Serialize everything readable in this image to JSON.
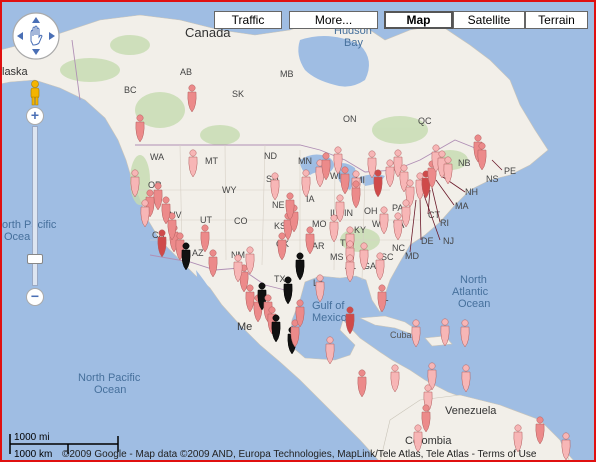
{
  "map": {
    "labels": {
      "canada": "Canada",
      "hudson_bay_1": "Hudson",
      "hudson_bay_2": "Bay",
      "alaska": "laska",
      "north_pacific_1": "orth Pacific",
      "north_pacific_2": "Ocea",
      "north_pacific_lower_1": "North Pacific",
      "north_pacific_lower_2": "Ocean",
      "gulf_1": "Gulf of",
      "gulf_2": "Mexico",
      "north_atlantic_1": "North",
      "north_atlantic_2": "Atlantic",
      "north_atlantic_3": "Ocean",
      "cuba": "Cuba",
      "venezuela": "Venezuela",
      "colombia": "Colombia",
      "mexico": "Me",
      "provinces": {
        "bc": "BC",
        "ab": "AB",
        "sk": "SK",
        "mb": "MB",
        "on": "ON",
        "qc": "QC",
        "nb": "NB",
        "ns": "NS",
        "pe": "PE"
      },
      "states": {
        "wa": "WA",
        "or": "OR",
        "mt": "MT",
        "nd": "ND",
        "mn": "MN",
        "wi": "WI",
        "mi": "MI",
        "wy": "WY",
        "sd": "SD",
        "ne": "NE",
        "ia": "IA",
        "il": "IL",
        "in": "IN",
        "oh": "OH",
        "pa": "PA",
        "nv": "NV",
        "ut": "UT",
        "co": "CO",
        "ks": "KS",
        "mo": "MO",
        "ky": "KY",
        "wv": "WV",
        "va": "VA",
        "ca": "CA",
        "az": "AZ",
        "nm": "NM",
        "ok": "OK",
        "ar": "AR",
        "tn": "TN",
        "nc": "NC",
        "sc": "SC",
        "ga": "GA",
        "al": "AL",
        "ms": "MS",
        "la": "LA",
        "tx": "TX",
        "fl": "FL",
        "md": "MD",
        "de": "DE",
        "nj": "NJ",
        "ct": "CT",
        "ri": "RI",
        "ma": "MA",
        "nh": "NH"
      }
    }
  },
  "controls": {
    "traffic": "Traffic",
    "more": "More...",
    "map": "Map",
    "satellite": "Satellite",
    "terrain": "Terrain",
    "zoom_in": "+",
    "zoom_out": "−"
  },
  "scale": {
    "top": "1000 mi",
    "bottom": "1000 km"
  },
  "copyright": "©2009 Google - Map data ©2009 AND, Europa Technologies, MapLink/Tele Atlas, Tele Atlas - Terms of Use",
  "colors": {
    "water": "#9fbde3",
    "land": "#f2efe9",
    "forest": "#c6dcb0",
    "marker_light": "#f7b6b6",
    "marker_mid": "#ec8a8a",
    "marker_dark": "#cf4a4a",
    "marker_black": "#111111"
  }
}
